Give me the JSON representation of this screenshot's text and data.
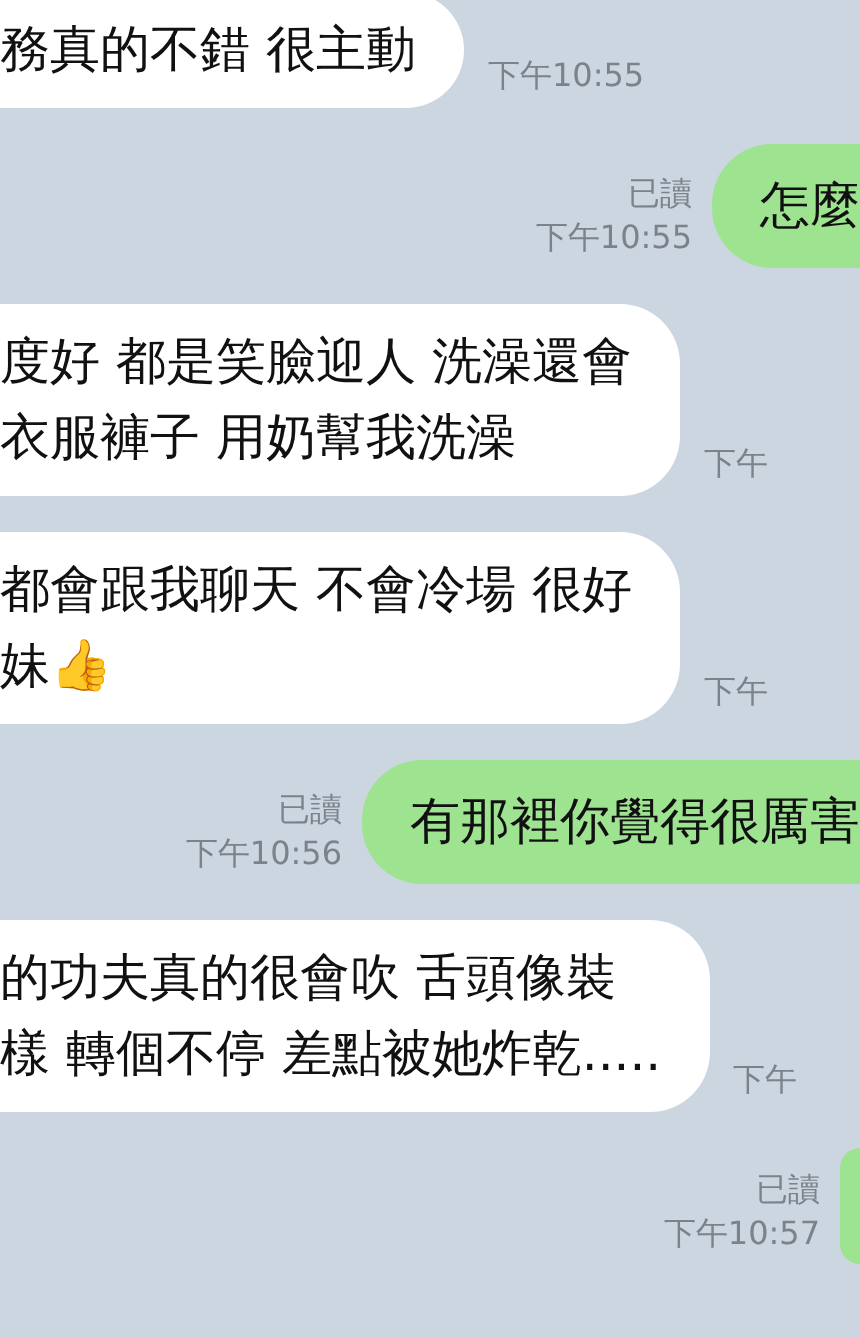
{
  "messages": [
    {
      "kind": "incoming",
      "lines": [
        "務真的不錯 很主動"
      ],
      "time": "下午10:55"
    },
    {
      "kind": "outgoing",
      "lines": [
        "怎麼"
      ],
      "read_label": "已讀",
      "time": "下午10:55"
    },
    {
      "kind": "incoming",
      "lines": [
        "度好 都是笑臉迎人 洗澡還會",
        "衣服褲子 用奶幫我洗澡"
      ],
      "time": "下午"
    },
    {
      "kind": "incoming",
      "lines": [
        "都會跟我聊天 不會冷場 很好",
        "妹👍"
      ],
      "time": "下午"
    },
    {
      "kind": "outgoing",
      "lines": [
        "有那裡你覺得很厲害"
      ],
      "read_label": "已讀",
      "time": "下午10:56"
    },
    {
      "kind": "incoming",
      "lines": [
        "的功夫真的很會吹 舌頭像裝",
        "樣 轉個不停 差點被她炸乾....."
      ],
      "time": "下午"
    },
    {
      "kind": "outgoing",
      "read_label": "已讀",
      "time": "下午10:57"
    }
  ]
}
